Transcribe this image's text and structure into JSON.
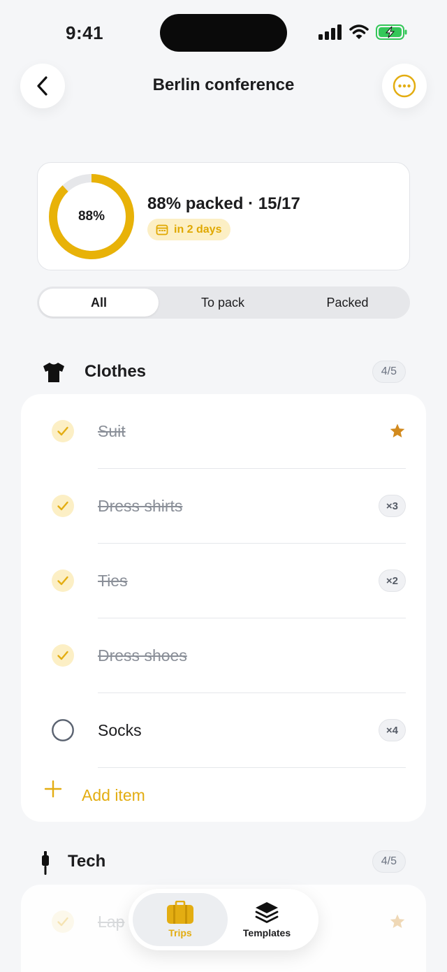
{
  "status_bar": {
    "time": "9:41"
  },
  "header": {
    "title": "Berlin conference"
  },
  "progress": {
    "percent": 88,
    "percent_label": "88%",
    "heading": "88% packed · 15/17",
    "due_label": "in 2 days"
  },
  "filters": {
    "tabs": [
      {
        "label": "All"
      },
      {
        "label": "To pack"
      },
      {
        "label": "Packed"
      }
    ],
    "selected": "All"
  },
  "sections": [
    {
      "title": "Clothes",
      "count": "4/5",
      "items": [
        {
          "label": "Suit",
          "packed": true,
          "badge": "",
          "starred": true
        },
        {
          "label": "Dress shirts",
          "packed": true,
          "badge": "×3"
        },
        {
          "label": "Ties",
          "packed": true,
          "badge": "×2"
        },
        {
          "label": "Dress shoes",
          "packed": true,
          "badge": ""
        },
        {
          "label": "Socks",
          "packed": false,
          "badge": "×4"
        }
      ],
      "add_label": "Add item"
    },
    {
      "title": "Tech",
      "count": "4/5",
      "items": [
        {
          "label": "Lap",
          "packed": true,
          "starred": true
        }
      ]
    }
  ],
  "tabbar": {
    "tabs": [
      {
        "label": "Trips",
        "icon": "suitcase-icon"
      },
      {
        "label": "Templates",
        "icon": "layers-icon"
      }
    ]
  },
  "colors": {
    "accent": "#e3ad12",
    "accent_soft": "#fcefc5",
    "star": "#d28a1e",
    "background": "#f5f6f8"
  }
}
